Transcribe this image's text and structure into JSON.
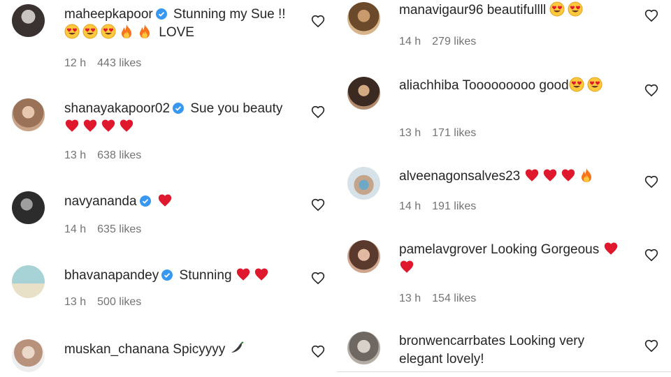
{
  "left_comments": [
    {
      "username": "maheepkapoor",
      "verified": true,
      "text_before": "Stunning my Sue !!",
      "emojis": [
        "heart-eyes",
        "heart-eyes",
        "heart-eyes",
        "fire",
        "fire"
      ],
      "text_after": "LOVE",
      "time": "12 h",
      "likes": "443 likes"
    },
    {
      "username": "shanayakapoor02",
      "verified": true,
      "text_before": "Sue you beauty",
      "emojis": [
        "red-heart",
        "red-heart",
        "red-heart",
        "red-heart"
      ],
      "text_after": "",
      "time": "13 h",
      "likes": "638 likes"
    },
    {
      "username": "navyananda",
      "verified": true,
      "text_before": "",
      "emojis": [
        "red-heart"
      ],
      "text_after": "",
      "time": "14 h",
      "likes": "635 likes"
    },
    {
      "username": "bhavanapandey",
      "verified": true,
      "text_before": "Stunning",
      "emojis": [
        "red-heart",
        "red-heart"
      ],
      "text_after": "",
      "time": "13 h",
      "likes": "500 likes"
    },
    {
      "username": "muskan_chanana",
      "verified": false,
      "text_before": "Spicyyyy",
      "emojis": [
        "chili"
      ],
      "text_after": "",
      "time": "",
      "likes": ""
    }
  ],
  "right_comments": [
    {
      "username": "manavigaur96",
      "verified": false,
      "text_before": "beautifullll",
      "emojis": [
        "heart-eyes",
        "heart-eyes"
      ],
      "text_after": "",
      "time": "14 h",
      "likes": "279 likes"
    },
    {
      "username": "aliachhiba",
      "verified": false,
      "text_before": "Tooooooooo good",
      "emojis": [
        "heart-eyes",
        "heart-eyes"
      ],
      "text_after": "",
      "time": "13 h",
      "likes": "171 likes"
    },
    {
      "username": "alveenagonsalves23",
      "verified": false,
      "text_before": "",
      "emojis": [
        "red-heart",
        "red-heart",
        "red-heart",
        "fire"
      ],
      "text_after": "",
      "time": "14 h",
      "likes": "191 likes"
    },
    {
      "username": "pamelavgrover",
      "verified": false,
      "text_before": "Looking Gorgeous",
      "emojis": [
        "red-heart",
        "red-heart"
      ],
      "text_after": "",
      "time": "13 h",
      "likes": "154 likes"
    },
    {
      "username": "bronwencarrbates",
      "verified": false,
      "text_before": "Looking very elegant lovely!",
      "emojis": [],
      "text_after": "",
      "time": "",
      "likes": ""
    }
  ],
  "colors": {
    "text": "#262626",
    "meta": "#737373",
    "verified": "#3897f0",
    "heart": "#e0182d"
  }
}
